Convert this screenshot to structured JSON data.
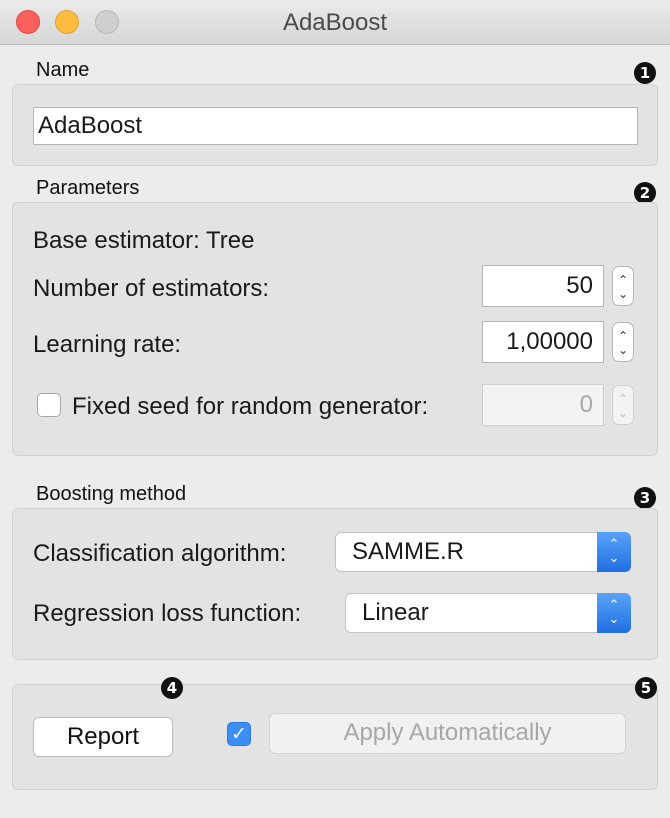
{
  "window": {
    "title": "AdaBoost"
  },
  "name_section": {
    "label": "Name",
    "value": "AdaBoost",
    "badge": "1"
  },
  "parameters": {
    "label": "Parameters",
    "badge": "2",
    "base_estimator": "Base estimator: Tree",
    "n_estimators_label": "Number of estimators:",
    "n_estimators_value": "50",
    "learning_rate_label": "Learning rate:",
    "learning_rate_value": "1,00000",
    "fixed_seed_label": "Fixed seed for random generator:",
    "fixed_seed_checked": false,
    "fixed_seed_value": "0"
  },
  "boosting": {
    "label": "Boosting method",
    "badge": "3",
    "classification_label": "Classification algorithm:",
    "classification_value": "SAMME.R",
    "regression_label": "Regression loss function:",
    "regression_value": "Linear"
  },
  "footer": {
    "badge_report": "4",
    "badge_apply": "5",
    "report_label": "Report",
    "apply_checked": true,
    "apply_label": "Apply Automatically"
  },
  "icons": {
    "check": "✓",
    "up": "⌃",
    "down": "⌄"
  }
}
